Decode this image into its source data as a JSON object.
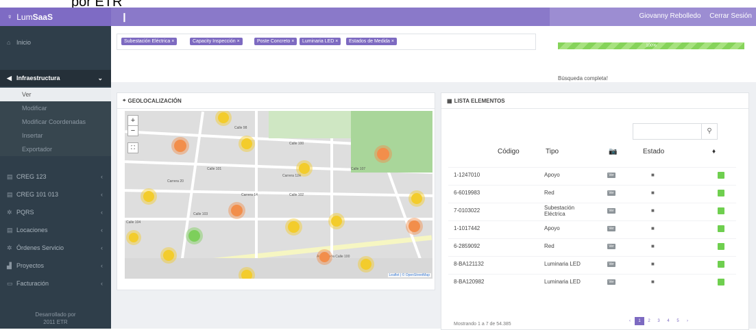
{
  "caption": "por ETR",
  "brand": {
    "prefix": "Lum",
    "name": "SaaS"
  },
  "topbar": {
    "menu_icon": "menu-icon",
    "user_name": "Giovanny Rebolledo",
    "logout": "Cerrar Sesión"
  },
  "sidebar": {
    "items": [
      {
        "label": "Inicio",
        "icon": "home-icon"
      },
      {
        "label": "Infraestructura",
        "icon": "chevron-left-icon"
      }
    ],
    "subitems": [
      "Ver",
      "Modificar",
      "Modificar Coordenadas",
      "Insertar",
      "Exportador"
    ],
    "items_after": [
      {
        "label": "CREG 123",
        "icon": "doc-icon"
      },
      {
        "label": "CREG 101 013",
        "icon": "doc-icon"
      },
      {
        "label": "PQRS",
        "icon": "gear-icon"
      },
      {
        "label": "Locaciones",
        "icon": "doc-icon"
      },
      {
        "label": "Órdenes Servicio",
        "icon": "gear-icon"
      },
      {
        "label": "Proyectos",
        "icon": "chart-icon"
      },
      {
        "label": "Facturación",
        "icon": "card-icon"
      }
    ],
    "footer_line1": "Desarrollado por",
    "footer_line2": "2011 ETR"
  },
  "filters": {
    "chips": [
      "Subestación Eléctrica ×",
      "Capacity Inspección ×",
      "Poste Concreto ×",
      "Luminaria LED ×",
      "Estados de Medida ×"
    ]
  },
  "progress": {
    "label": "100%",
    "value": 1.0,
    "status": "Búsqueda completa!"
  },
  "map_panel": {
    "title": "GEOLOCALIZACIÓN",
    "zoom_in": "+",
    "zoom_out": "−",
    "fullscreen": "⛶",
    "attribution": "Leaflet | © OpenStreetMap",
    "streets": [
      "Calle 98",
      "Calle 100",
      "Calle 101",
      "Calle 102",
      "Calle 103",
      "Calle 104",
      "Calle 107",
      "Av. Avenida Calle 100",
      "Carrera 20",
      "Carrera 14",
      "Carrera 12A"
    ],
    "clusters": [
      {
        "color": "yellow"
      },
      {
        "color": "orange"
      },
      {
        "color": "yellow"
      },
      {
        "color": "yellow"
      },
      {
        "color": "orange"
      },
      {
        "color": "yellow"
      },
      {
        "color": "orange"
      },
      {
        "color": "yellow"
      },
      {
        "color": "yellow"
      },
      {
        "color": "orange"
      },
      {
        "color": "yellow"
      },
      {
        "color": "green"
      },
      {
        "color": "yellow"
      },
      {
        "color": "yellow"
      },
      {
        "color": "yellow"
      },
      {
        "color": "orange"
      },
      {
        "color": "yellow"
      }
    ]
  },
  "list_panel": {
    "title": "LISTA ELEMENTOS",
    "search_placeholder": "",
    "search_icon": "search-icon",
    "columns": [
      "Código",
      "Tipo",
      "📷",
      "Estado",
      "♦"
    ],
    "rows": [
      {
        "code": "1-1247010",
        "type": "Apoyo"
      },
      {
        "code": "6-6019983",
        "type": "Red"
      },
      {
        "code": "7-0103022",
        "type": "Subestación Eléctrica"
      },
      {
        "code": "1-1017442",
        "type": "Apoyo"
      },
      {
        "code": "6-2859092",
        "type": "Red"
      },
      {
        "code": "8-BA121132",
        "type": "Luminaria LED"
      },
      {
        "code": "8-BA120982",
        "type": "Luminaria LED"
      }
    ],
    "info_button": "Ver",
    "footer": "Mostrando 1 a 7 de 54.385",
    "pages": [
      "‹",
      "1",
      "2",
      "3",
      "4",
      "5",
      "›"
    ]
  }
}
